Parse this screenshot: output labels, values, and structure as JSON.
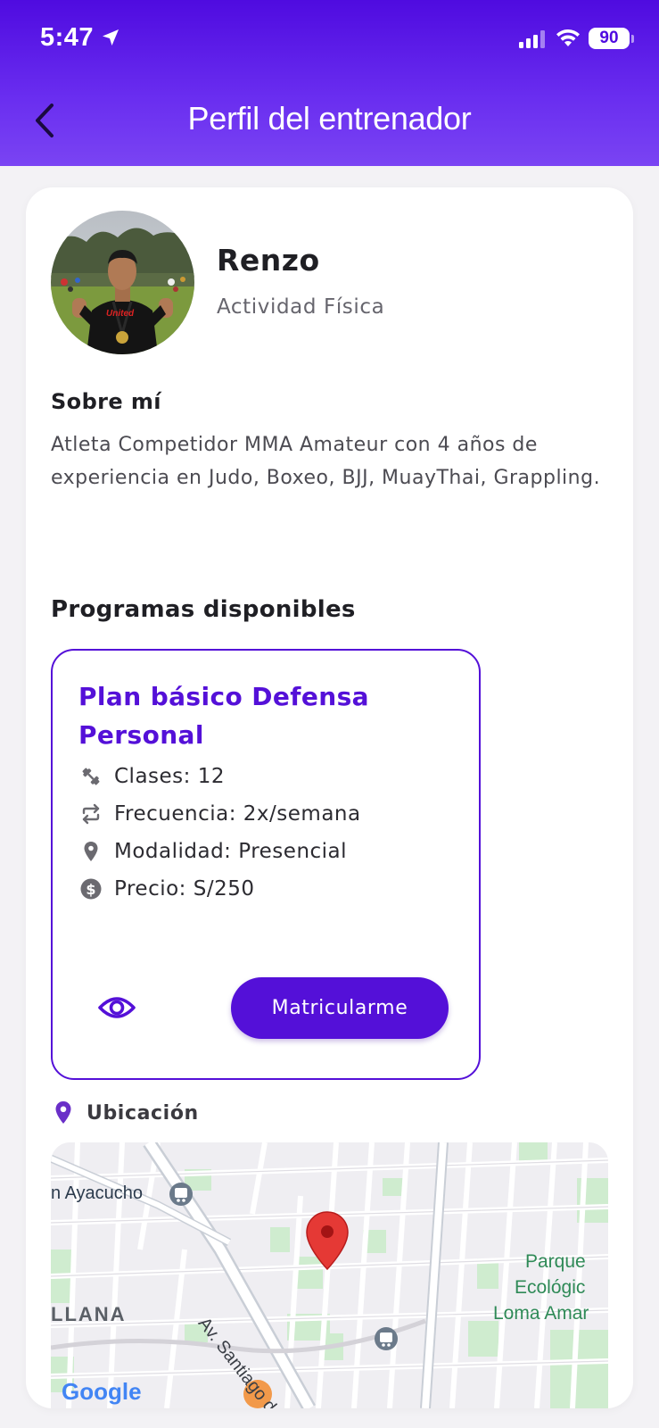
{
  "status_bar": {
    "time": "5:47",
    "battery": "90"
  },
  "header": {
    "title": "Perfil del entrenador"
  },
  "trainer": {
    "name": "Renzo",
    "category": "Actividad Física"
  },
  "about": {
    "title": "Sobre mí",
    "text": "Atleta Competidor MMA Amateur con 4 años de experiencia en Judo, Boxeo, BJJ, MuayThai, Grappling."
  },
  "programs": {
    "title": "Programas disponibles",
    "items": [
      {
        "name": "Plan básico Defensa Personal",
        "classes": "Clases: 12",
        "frequency": "Frecuencia: 2x/semana",
        "modality": "Modalidad: Presencial",
        "price": "Precio: S/250",
        "enroll_label": "Matricularme"
      }
    ]
  },
  "location": {
    "title": "Ubicación",
    "map_labels": {
      "station": "n Ayacucho",
      "street": "Av. Santiago de",
      "district": "LLANA",
      "park_1": "Parque",
      "park_2": "Ecológic",
      "park_3": "Loma Amar",
      "google": "Google"
    }
  },
  "colors": {
    "primary": "#5410d8",
    "header_top": "#4f0be0",
    "pin": "#e53935"
  }
}
